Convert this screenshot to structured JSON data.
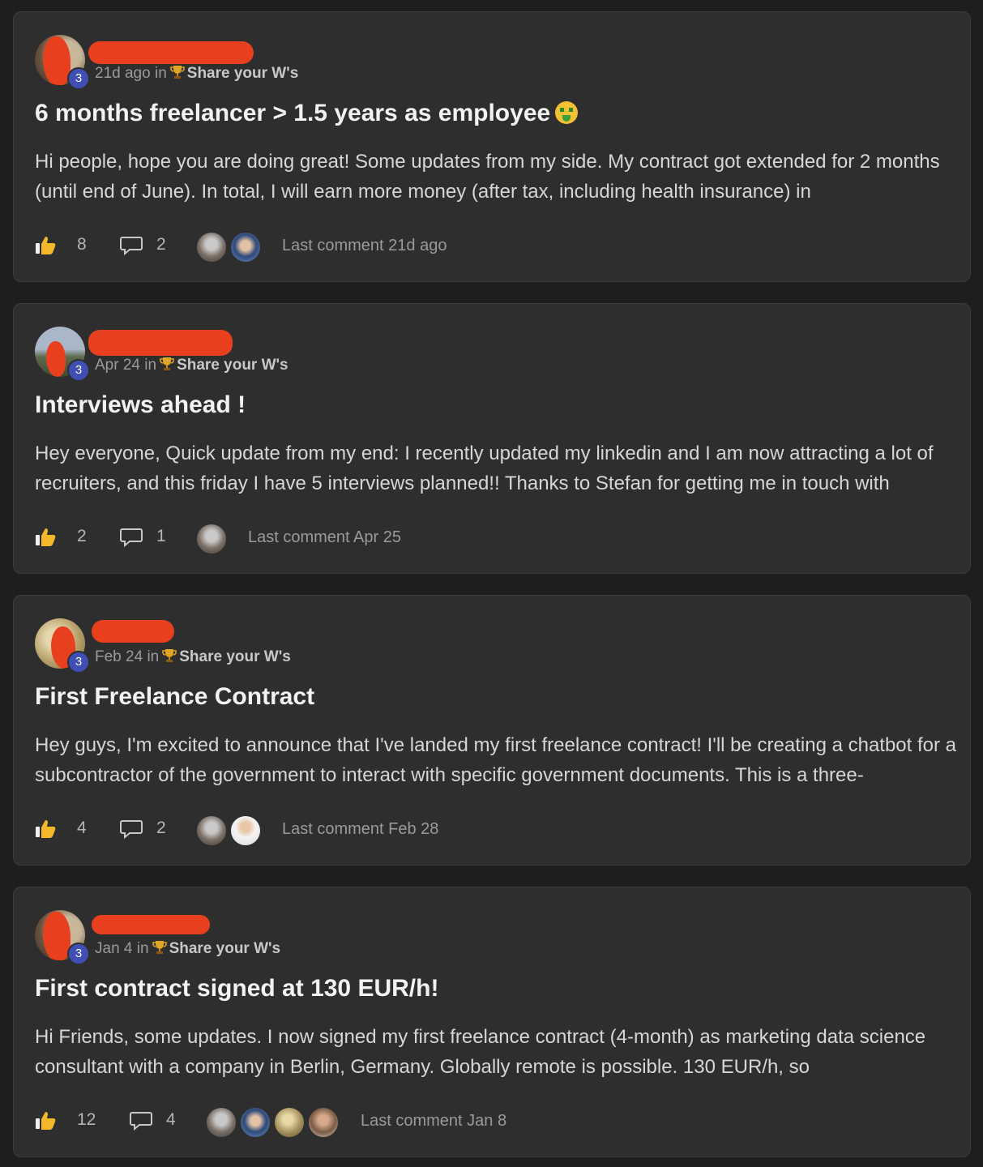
{
  "posts": [
    {
      "level": "3",
      "time": "21d ago",
      "in_word": "in",
      "category": "Share your W's",
      "title": "6 months freelancer > 1.5 years as employee",
      "has_emoji": true,
      "body": "Hi people, hope you are doing great! Some updates from my side. My contract got extended for 2 months (until end of June). In total, I will earn more money (after tax, including health insurance) in",
      "likes": "8",
      "comments": "2",
      "last_comment": "Last comment 21d ago"
    },
    {
      "level": "3",
      "time": "Apr 24",
      "in_word": "in",
      "category": "Share your W's",
      "title": "Interviews ahead !",
      "has_emoji": false,
      "body": "Hey everyone, Quick update from my end: I recently updated my linkedin and I am now attracting a lot of recruiters, and this friday I have 5 interviews planned!! Thanks to Stefan for getting me in touch with",
      "likes": "2",
      "comments": "1",
      "last_comment": "Last comment Apr 25"
    },
    {
      "level": "3",
      "time": "Feb 24",
      "in_word": "in",
      "category": "Share your W's",
      "title": "First Freelance Contract",
      "has_emoji": false,
      "body": "Hey guys, I'm excited to announce that I've landed my first freelance contract! I'll be creating a chatbot for a subcontractor of the government to interact with specific government documents. This is a three-",
      "likes": "4",
      "comments": "2",
      "last_comment": "Last comment Feb 28"
    },
    {
      "level": "3",
      "time": "Jan 4",
      "in_word": "in",
      "category": "Share your W's",
      "title": "First contract signed at 130 EUR/h!",
      "has_emoji": false,
      "body": "Hi Friends, some updates. I now signed my first freelance contract (4-month) as marketing data science consultant with a company in Berlin, Germany. Globally remote is possible. 130 EUR/h, so",
      "likes": "12",
      "comments": "4",
      "last_comment": "Last comment Jan 8"
    }
  ],
  "colors": {
    "background": "#1e1e1e",
    "card": "#2e2e2e",
    "level_badge": "#3f4fb3",
    "redaction": "#e8401f"
  },
  "icons": {
    "like": "thumbs-up-icon",
    "comment": "speech-bubble-icon",
    "category": "trophy-icon"
  }
}
